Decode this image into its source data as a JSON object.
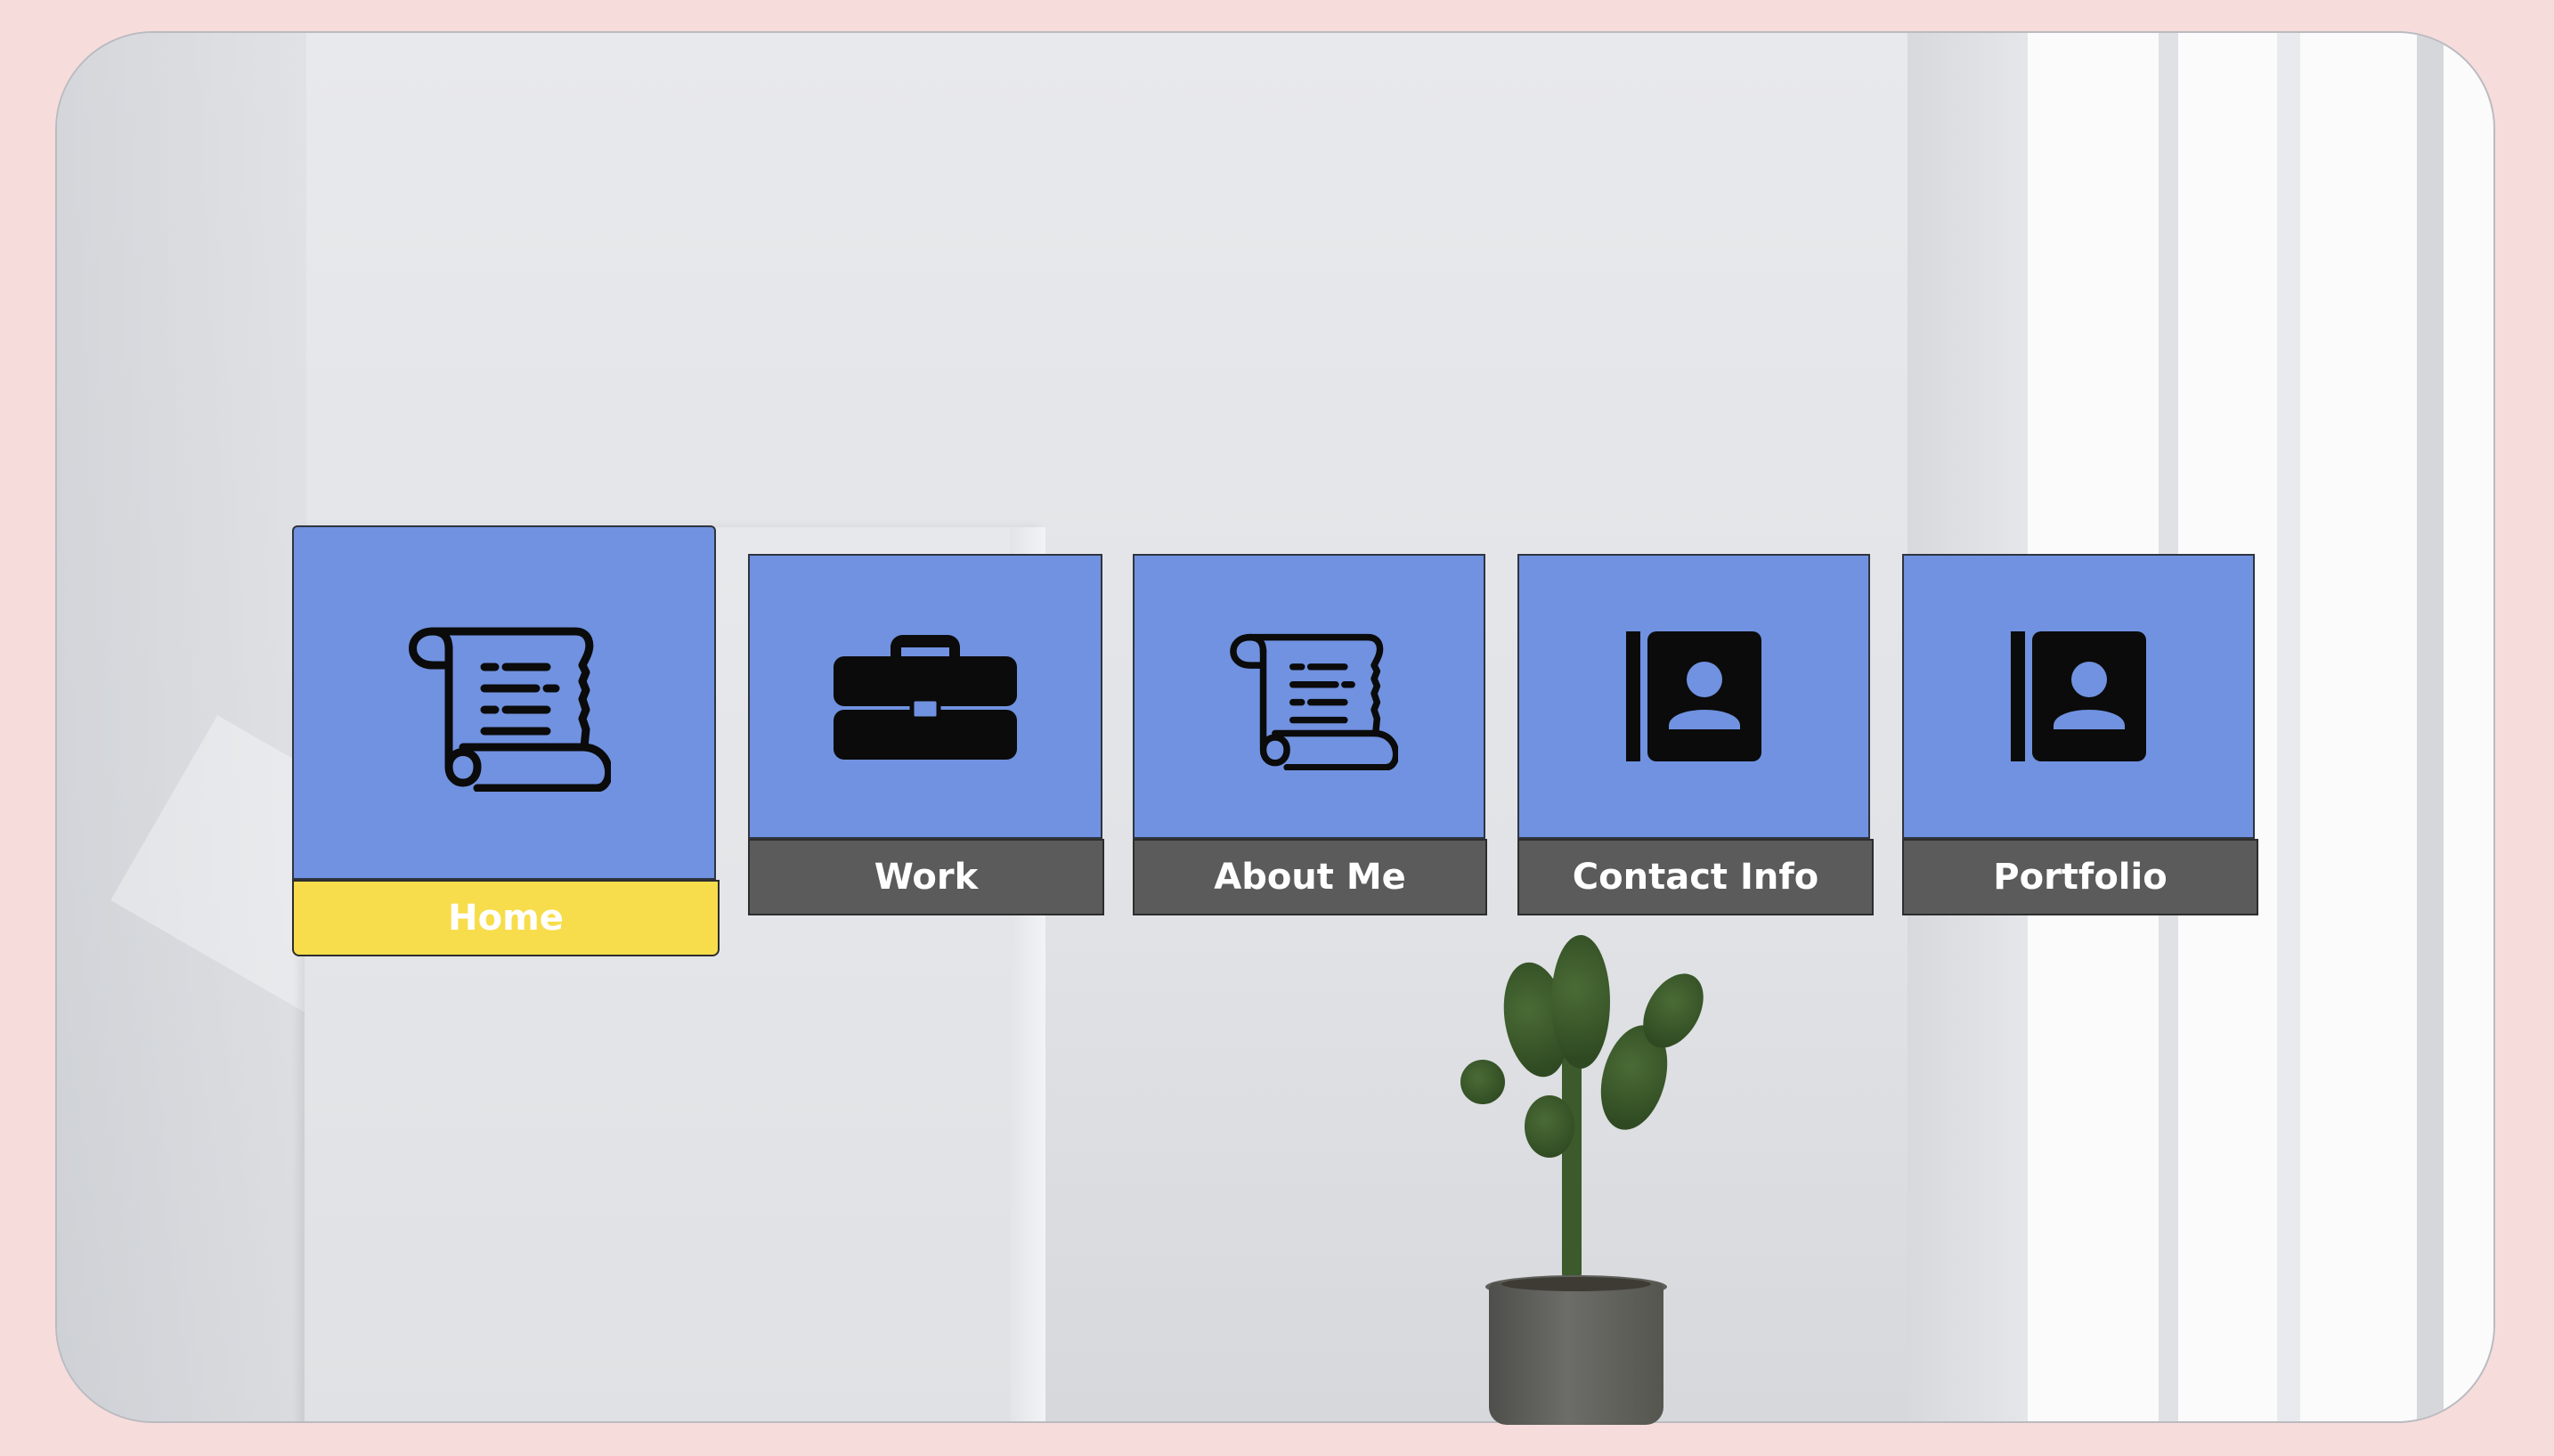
{
  "nav": {
    "items": [
      {
        "label": "Home",
        "icon": "scroll-icon",
        "active": true
      },
      {
        "label": "Work",
        "icon": "briefcase-icon",
        "active": false
      },
      {
        "label": "About Me",
        "icon": "scroll-icon",
        "active": false
      },
      {
        "label": "Contact Info",
        "icon": "contact-book-icon",
        "active": false
      },
      {
        "label": "Portfolio",
        "icon": "contact-book-icon",
        "active": false
      }
    ]
  },
  "colors": {
    "tile": "#7092e0",
    "label": "#5b5b5b",
    "active_label": "#f7dd4c",
    "page_background": "#f7dcdc"
  }
}
